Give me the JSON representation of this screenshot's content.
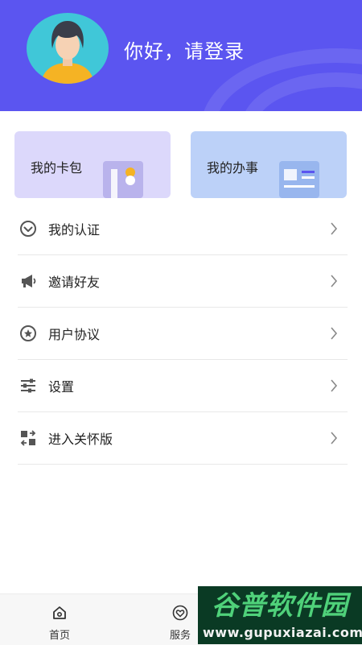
{
  "header": {
    "greeting": "你好，请登录",
    "avatar_icon": "user-avatar-icon",
    "background_color": "#5b55f0"
  },
  "cards": [
    {
      "label": "我的卡包",
      "icon": "card-wallet-icon",
      "background_color": "#dcd8fb"
    },
    {
      "label": "我的办事",
      "icon": "document-icon",
      "background_color": "#bcd1f8"
    }
  ],
  "menu": {
    "items": [
      {
        "label": "我的认证",
        "icon": "shield-check-icon"
      },
      {
        "label": "邀请好友",
        "icon": "megaphone-icon"
      },
      {
        "label": "用户协议",
        "icon": "star-badge-icon"
      },
      {
        "label": "设置",
        "icon": "sliders-icon"
      },
      {
        "label": "进入关怀版",
        "icon": "switch-mode-icon"
      }
    ]
  },
  "tabbar": {
    "tabs": [
      {
        "label": "首页",
        "icon": "home-icon"
      },
      {
        "label": "服务",
        "icon": "heart-icon"
      }
    ]
  },
  "watermark": {
    "logo_text": "谷普软件园",
    "url": "www.gupuxiazai.com"
  }
}
